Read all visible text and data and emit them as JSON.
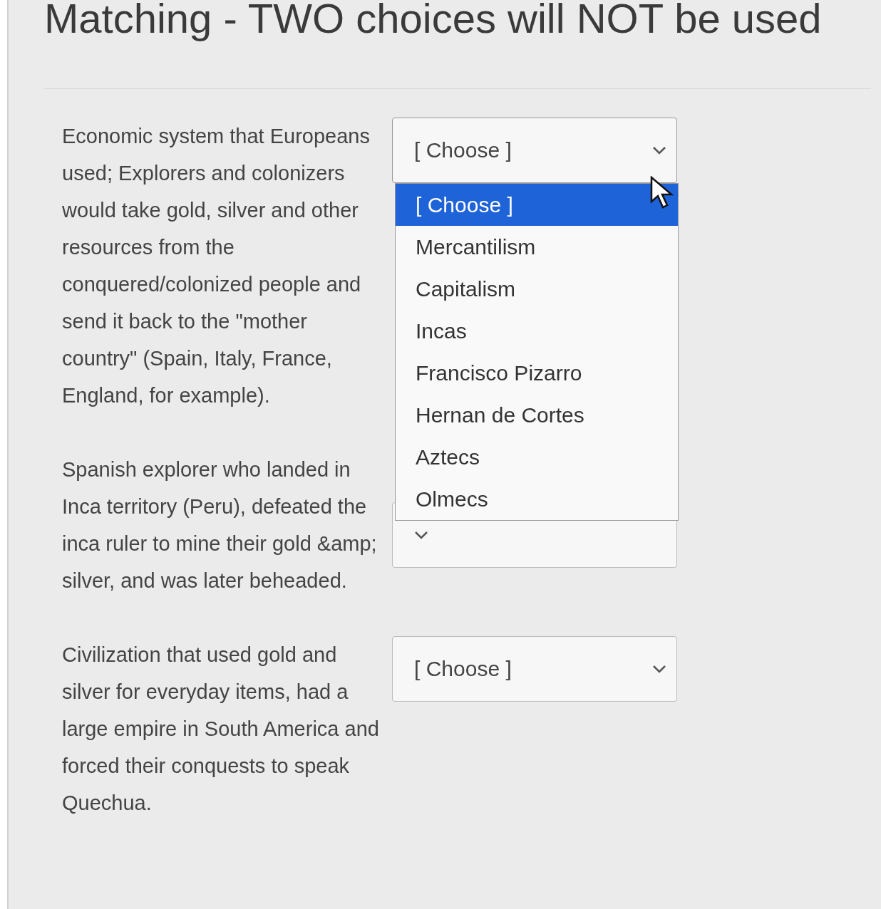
{
  "title": "Matching - TWO choices will NOT be used",
  "questions": [
    {
      "prompt": "Economic system that Europeans used; Explorers and colonizers would take gold, silver and other resources from the conquered/colonized people and send it back to the \"mother country\" (Spain, Italy, France, England, for example).",
      "select": {
        "value": "[ Choose ]",
        "expanded": true,
        "options": [
          {
            "label": "[ Choose ]",
            "selected": true
          },
          {
            "label": "Mercantilism",
            "selected": false
          },
          {
            "label": "Capitalism",
            "selected": false
          },
          {
            "label": "Incas",
            "selected": false
          },
          {
            "label": "Francisco Pizarro",
            "selected": false
          },
          {
            "label": "Hernan de Cortes",
            "selected": false
          },
          {
            "label": "Aztecs",
            "selected": false
          },
          {
            "label": "Olmecs",
            "selected": false
          }
        ]
      }
    },
    {
      "prompt": "Spanish explorer who landed in Inca territory (Peru), defeated the inca ruler to mine their gold &amp; silver, and was later beheaded.",
      "select": {
        "expanded": false
      }
    },
    {
      "prompt": "Civilization that used gold and silver for everyday items, had a large empire in South America and forced their conquests to speak Quechua.",
      "select": {
        "value": "[ Choose ]",
        "expanded": false
      }
    }
  ]
}
